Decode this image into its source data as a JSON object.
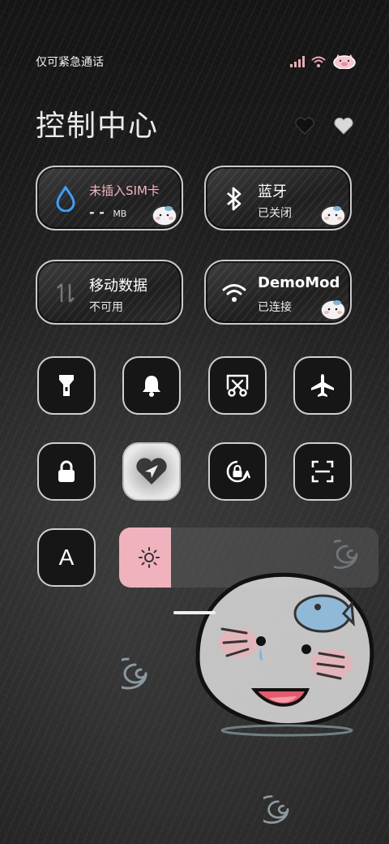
{
  "status": {
    "carrier_text": "仅可紧急通话",
    "icons": [
      "signal-icon",
      "wifi-icon",
      "pig-battery-icon"
    ],
    "accent": "#f0a8b4"
  },
  "header": {
    "title": "控制中心",
    "hearts": [
      "black-heart-icon",
      "white-heart-icon"
    ]
  },
  "tiles": {
    "sim": {
      "label": "未插入SIM卡",
      "value": "- -",
      "unit": "MB",
      "label_color": "#f4b7c2",
      "icon": "droplet-icon",
      "icon_color": "#3aa0ff"
    },
    "bluetooth": {
      "label": "蓝牙",
      "status": "已关闭",
      "icon": "bluetooth-icon"
    },
    "mobile_data": {
      "label": "移动数据",
      "status": "不可用",
      "icon": "data-arrows-icon"
    },
    "wifi": {
      "label": "DemoMod",
      "status": "已连接",
      "icon": "wifi-icon"
    }
  },
  "toggles": [
    {
      "id": "flashlight",
      "icon": "flashlight-icon"
    },
    {
      "id": "bell",
      "icon": "bell-icon"
    },
    {
      "id": "screenshot",
      "icon": "scissors-icon"
    },
    {
      "id": "airplane",
      "icon": "airplane-icon"
    },
    {
      "id": "lock",
      "icon": "lock-icon"
    },
    {
      "id": "location",
      "icon": "location-arrow-icon",
      "active": true
    },
    {
      "id": "rotation",
      "icon": "rotation-lock-icon"
    },
    {
      "id": "scan",
      "icon": "scan-icon"
    },
    {
      "id": "font",
      "icon": "font-icon",
      "glyph": "A"
    }
  ],
  "brightness": {
    "level": 0.2,
    "icon": "sun-icon",
    "fill_color": "#f0b2bd"
  }
}
